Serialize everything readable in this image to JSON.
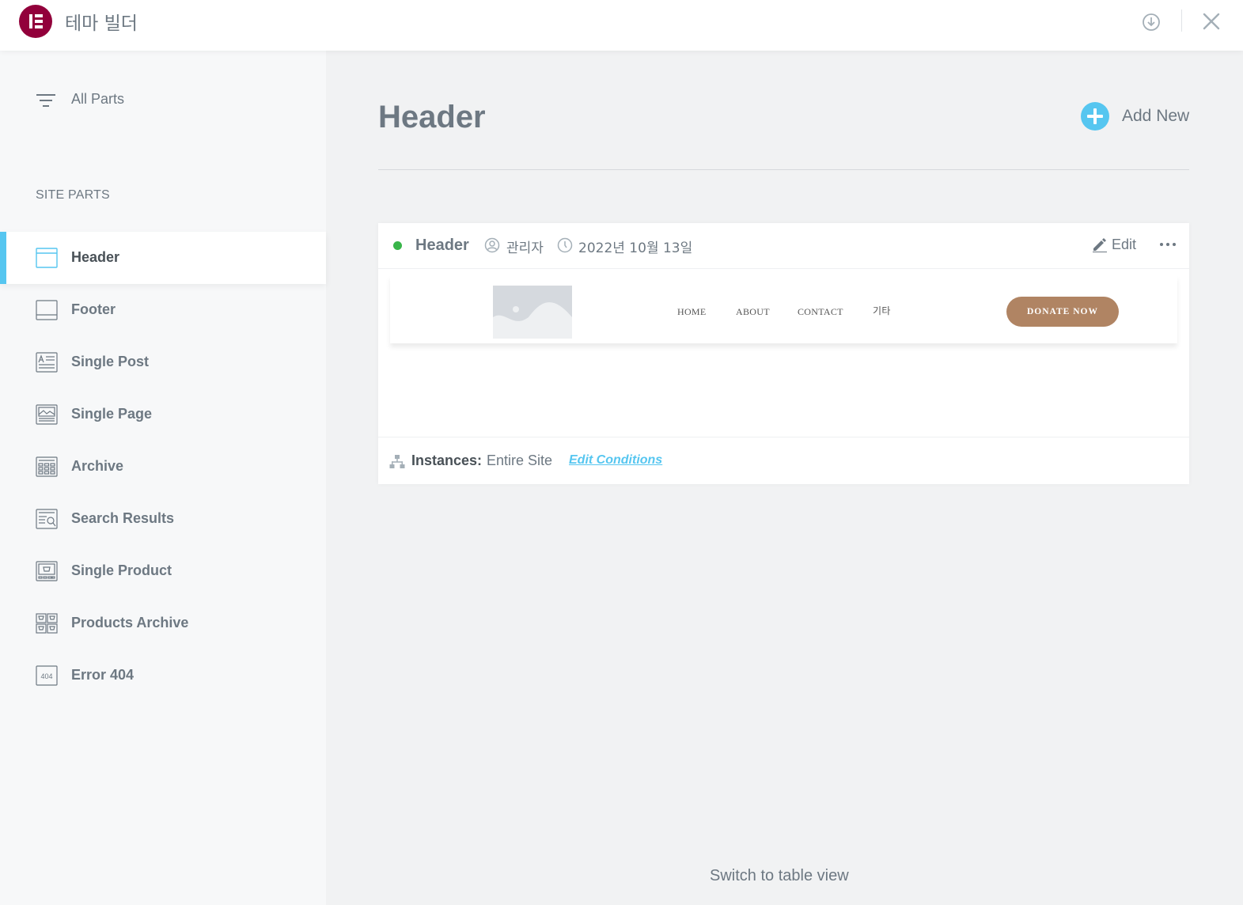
{
  "app": {
    "title": "테마 빌더"
  },
  "sidebar": {
    "all_parts_label": "All Parts",
    "section_title": "SITE PARTS",
    "items": [
      {
        "label": "Header",
        "icon": "header-icon",
        "active": true
      },
      {
        "label": "Footer",
        "icon": "footer-icon"
      },
      {
        "label": "Single Post",
        "icon": "single-post-icon"
      },
      {
        "label": "Single Page",
        "icon": "single-page-icon"
      },
      {
        "label": "Archive",
        "icon": "archive-icon"
      },
      {
        "label": "Search Results",
        "icon": "search-results-icon"
      },
      {
        "label": "Single Product",
        "icon": "single-product-icon"
      },
      {
        "label": "Products Archive",
        "icon": "products-archive-icon"
      },
      {
        "label": "Error 404",
        "icon": "error-404-icon",
        "icon_text": "404"
      }
    ]
  },
  "main": {
    "title": "Header",
    "add_new_label": "Add New",
    "switch_view_label": "Switch to table view"
  },
  "card": {
    "status": "published",
    "title": "Header",
    "author": "관리자",
    "date": "2022년 10월 13일",
    "edit_label": "Edit",
    "preview": {
      "nav": [
        "HOME",
        "ABOUT",
        "CONTACT",
        "기타"
      ],
      "cta": "DONATE NOW"
    },
    "instances_label": "Instances:",
    "instances_value": "Entire Site",
    "edit_conditions_label": "Edit Conditions"
  },
  "colors": {
    "accent": "#56c6f0",
    "brand": "#92003b",
    "status_published": "#39b54a",
    "donate_button": "#b08463"
  }
}
